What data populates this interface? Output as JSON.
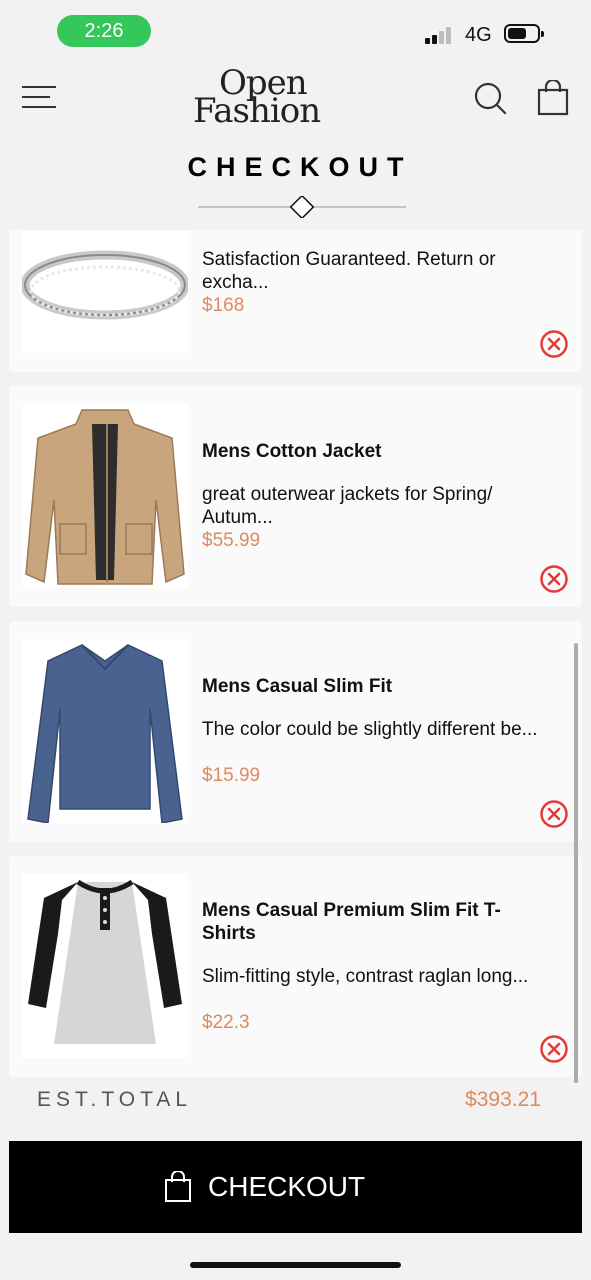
{
  "status_bar": {
    "time": "2:26",
    "network": "4G"
  },
  "header": {
    "logo_line1": "Open",
    "logo_line2": "Fashion",
    "title": "CHECKOUT"
  },
  "items": [
    {
      "name": "",
      "description": "Satisfaction Guaranteed. Return or excha...",
      "price": "$168",
      "image": "ring"
    },
    {
      "name": "Mens Cotton Jacket",
      "description": "great outerwear jackets for Spring/ Autum...",
      "price": "$55.99",
      "image": "jacket"
    },
    {
      "name": "Mens Casual Slim Fit",
      "description": "The color could be slightly different be...",
      "price": "$15.99",
      "image": "blue-long-sleeve-shirt"
    },
    {
      "name": "Mens Casual Premium Slim Fit T-Shirts",
      "description": "Slim-fitting style, contrast raglan long...",
      "price": "$22.3",
      "image": "raglan-henley-shirt"
    }
  ],
  "totals": {
    "label": "EST.TOTAL",
    "value": "$393.21"
  },
  "checkout_button": {
    "label": "CHECKOUT"
  },
  "colors": {
    "accent_price": "#dd8a5f",
    "remove_red": "#e53935",
    "status_green": "#34c759"
  }
}
